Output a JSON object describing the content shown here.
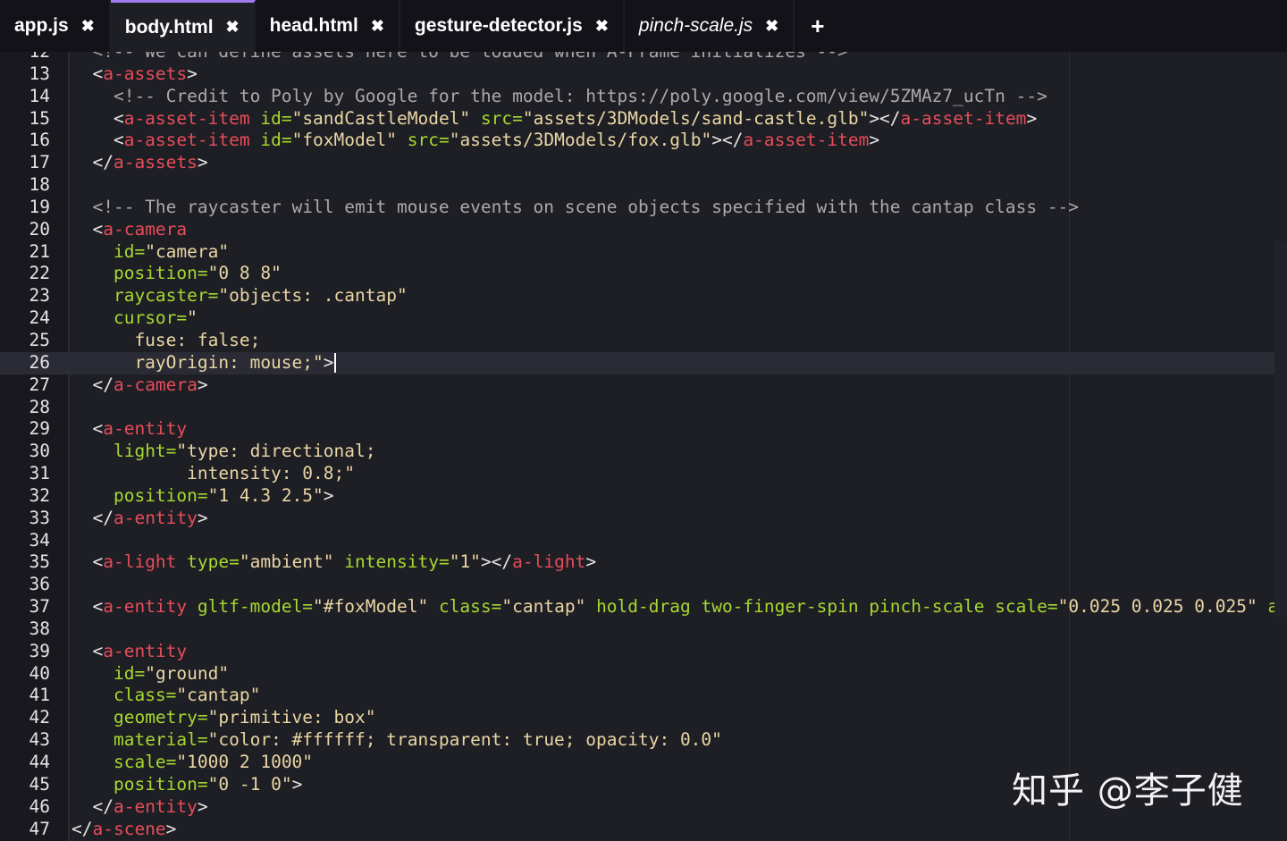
{
  "tabs": [
    {
      "label": "app.js",
      "close": "✖"
    },
    {
      "label": "body.html",
      "close": "✖"
    },
    {
      "label": "head.html",
      "close": "✖"
    },
    {
      "label": "gesture-detector.js",
      "close": "✖"
    },
    {
      "label": "pinch-scale.js",
      "close": "✖"
    }
  ],
  "add_tab_label": "+",
  "active_tab": "body.html",
  "current_line": 26,
  "colors": {
    "background": "#1e1e25",
    "tag": "#e64d5a",
    "attribute": "#a6d830",
    "string": "#ead6a4",
    "comment": "#aaaaaa",
    "active_tab_accent": "#a07cf0"
  },
  "code_lines": [
    {
      "n": "12",
      "tokens": [
        [
          "c",
          "  <!-- We can define assets here to be loaded when A-Frame initializes -->"
        ]
      ]
    },
    {
      "n": "13",
      "tokens": [
        [
          "p",
          "  <"
        ],
        [
          "t",
          "a-assets"
        ],
        [
          "p",
          ">"
        ]
      ]
    },
    {
      "n": "14",
      "tokens": [
        [
          "c",
          "    <!-- Credit to Poly by Google for the model: https://poly.google.com/view/5ZMAz7_ucTn -->"
        ]
      ]
    },
    {
      "n": "15",
      "tokens": [
        [
          "p",
          "    <"
        ],
        [
          "t",
          "a-asset-item"
        ],
        [
          "p",
          " "
        ],
        [
          "a",
          "id="
        ],
        [
          "s",
          "\"sandCastleModel\""
        ],
        [
          "p",
          " "
        ],
        [
          "a",
          "src="
        ],
        [
          "s",
          "\"assets/3DModels/sand-castle.glb\""
        ],
        [
          "p",
          "></"
        ],
        [
          "t",
          "a-asset-item"
        ],
        [
          "p",
          ">"
        ]
      ]
    },
    {
      "n": "16",
      "tokens": [
        [
          "p",
          "    <"
        ],
        [
          "t",
          "a-asset-item"
        ],
        [
          "p",
          " "
        ],
        [
          "a",
          "id="
        ],
        [
          "s",
          "\"foxModel\""
        ],
        [
          "p",
          " "
        ],
        [
          "a",
          "src="
        ],
        [
          "s",
          "\"assets/3DModels/fox.glb\""
        ],
        [
          "p",
          "></"
        ],
        [
          "t",
          "a-asset-item"
        ],
        [
          "p",
          ">"
        ]
      ]
    },
    {
      "n": "17",
      "tokens": [
        [
          "p",
          "  </"
        ],
        [
          "t",
          "a-assets"
        ],
        [
          "p",
          ">"
        ]
      ]
    },
    {
      "n": "18",
      "tokens": []
    },
    {
      "n": "19",
      "tokens": [
        [
          "c",
          "  <!-- The raycaster will emit mouse events on scene objects specified with the cantap class -->"
        ]
      ]
    },
    {
      "n": "20",
      "tokens": [
        [
          "p",
          "  <"
        ],
        [
          "t",
          "a-camera"
        ]
      ]
    },
    {
      "n": "21",
      "tokens": [
        [
          "p",
          "    "
        ],
        [
          "a",
          "id="
        ],
        [
          "s",
          "\"camera\""
        ]
      ]
    },
    {
      "n": "22",
      "tokens": [
        [
          "p",
          "    "
        ],
        [
          "a",
          "position="
        ],
        [
          "s",
          "\"0 8 8\""
        ]
      ]
    },
    {
      "n": "23",
      "tokens": [
        [
          "p",
          "    "
        ],
        [
          "a",
          "raycaster="
        ],
        [
          "s",
          "\"objects: .cantap\""
        ]
      ]
    },
    {
      "n": "24",
      "tokens": [
        [
          "p",
          "    "
        ],
        [
          "a",
          "cursor="
        ],
        [
          "s",
          "\""
        ]
      ]
    },
    {
      "n": "25",
      "tokens": [
        [
          "s",
          "      fuse: false;"
        ]
      ]
    },
    {
      "n": "26",
      "tokens": [
        [
          "s",
          "      rayOrigin: mouse;\""
        ],
        [
          "p",
          ">"
        ]
      ]
    },
    {
      "n": "27",
      "tokens": [
        [
          "p",
          "  </"
        ],
        [
          "t",
          "a-camera"
        ],
        [
          "p",
          ">"
        ]
      ]
    },
    {
      "n": "28",
      "tokens": []
    },
    {
      "n": "29",
      "tokens": [
        [
          "p",
          "  <"
        ],
        [
          "t",
          "a-entity"
        ]
      ]
    },
    {
      "n": "30",
      "tokens": [
        [
          "p",
          "    "
        ],
        [
          "a",
          "light="
        ],
        [
          "s",
          "\"type: directional;"
        ]
      ]
    },
    {
      "n": "31",
      "tokens": [
        [
          "s",
          "           intensity: 0.8;\""
        ]
      ]
    },
    {
      "n": "32",
      "tokens": [
        [
          "p",
          "    "
        ],
        [
          "a",
          "position="
        ],
        [
          "s",
          "\"1 4.3 2.5\""
        ],
        [
          "p",
          ">"
        ]
      ]
    },
    {
      "n": "33",
      "tokens": [
        [
          "p",
          "  </"
        ],
        [
          "t",
          "a-entity"
        ],
        [
          "p",
          ">"
        ]
      ]
    },
    {
      "n": "34",
      "tokens": []
    },
    {
      "n": "35",
      "tokens": [
        [
          "p",
          "  <"
        ],
        [
          "t",
          "a-light"
        ],
        [
          "p",
          " "
        ],
        [
          "a",
          "type="
        ],
        [
          "s",
          "\"ambient\""
        ],
        [
          "p",
          " "
        ],
        [
          "a",
          "intensity="
        ],
        [
          "s",
          "\"1\""
        ],
        [
          "p",
          "></"
        ],
        [
          "t",
          "a-light"
        ],
        [
          "p",
          ">"
        ]
      ]
    },
    {
      "n": "36",
      "tokens": []
    },
    {
      "n": "37",
      "tokens": [
        [
          "p",
          "  <"
        ],
        [
          "t",
          "a-entity"
        ],
        [
          "p",
          " "
        ],
        [
          "a",
          "gltf-model="
        ],
        [
          "s",
          "\"#foxModel\""
        ],
        [
          "p",
          " "
        ],
        [
          "a",
          "class="
        ],
        [
          "s",
          "\"cantap\""
        ],
        [
          "p",
          " "
        ],
        [
          "a",
          "hold-drag two-finger-spin pinch-scale scale="
        ],
        [
          "s",
          "\"0.025 0.025 0.025\""
        ],
        [
          "p",
          " "
        ],
        [
          "a",
          "animatio"
        ]
      ]
    },
    {
      "n": "38",
      "tokens": []
    },
    {
      "n": "39",
      "tokens": [
        [
          "p",
          "  <"
        ],
        [
          "t",
          "a-entity"
        ]
      ]
    },
    {
      "n": "40",
      "tokens": [
        [
          "p",
          "    "
        ],
        [
          "a",
          "id="
        ],
        [
          "s",
          "\"ground\""
        ]
      ]
    },
    {
      "n": "41",
      "tokens": [
        [
          "p",
          "    "
        ],
        [
          "a",
          "class="
        ],
        [
          "s",
          "\"cantap\""
        ]
      ]
    },
    {
      "n": "42",
      "tokens": [
        [
          "p",
          "    "
        ],
        [
          "a",
          "geometry="
        ],
        [
          "s",
          "\"primitive: box\""
        ]
      ]
    },
    {
      "n": "43",
      "tokens": [
        [
          "p",
          "    "
        ],
        [
          "a",
          "material="
        ],
        [
          "s",
          "\"color: #ffffff; transparent: true; opacity: 0.0\""
        ]
      ]
    },
    {
      "n": "44",
      "tokens": [
        [
          "p",
          "    "
        ],
        [
          "a",
          "scale="
        ],
        [
          "s",
          "\"1000 2 1000\""
        ]
      ]
    },
    {
      "n": "45",
      "tokens": [
        [
          "p",
          "    "
        ],
        [
          "a",
          "position="
        ],
        [
          "s",
          "\"0 -1 0\""
        ],
        [
          "p",
          ">"
        ]
      ]
    },
    {
      "n": "46",
      "tokens": [
        [
          "p",
          "  </"
        ],
        [
          "t",
          "a-entity"
        ],
        [
          "p",
          ">"
        ]
      ]
    },
    {
      "n": "47",
      "tokens": [
        [
          "p",
          "</"
        ],
        [
          "t",
          "a-scene"
        ],
        [
          "p",
          ">"
        ]
      ]
    }
  ],
  "watermark": "知乎 @李子健"
}
